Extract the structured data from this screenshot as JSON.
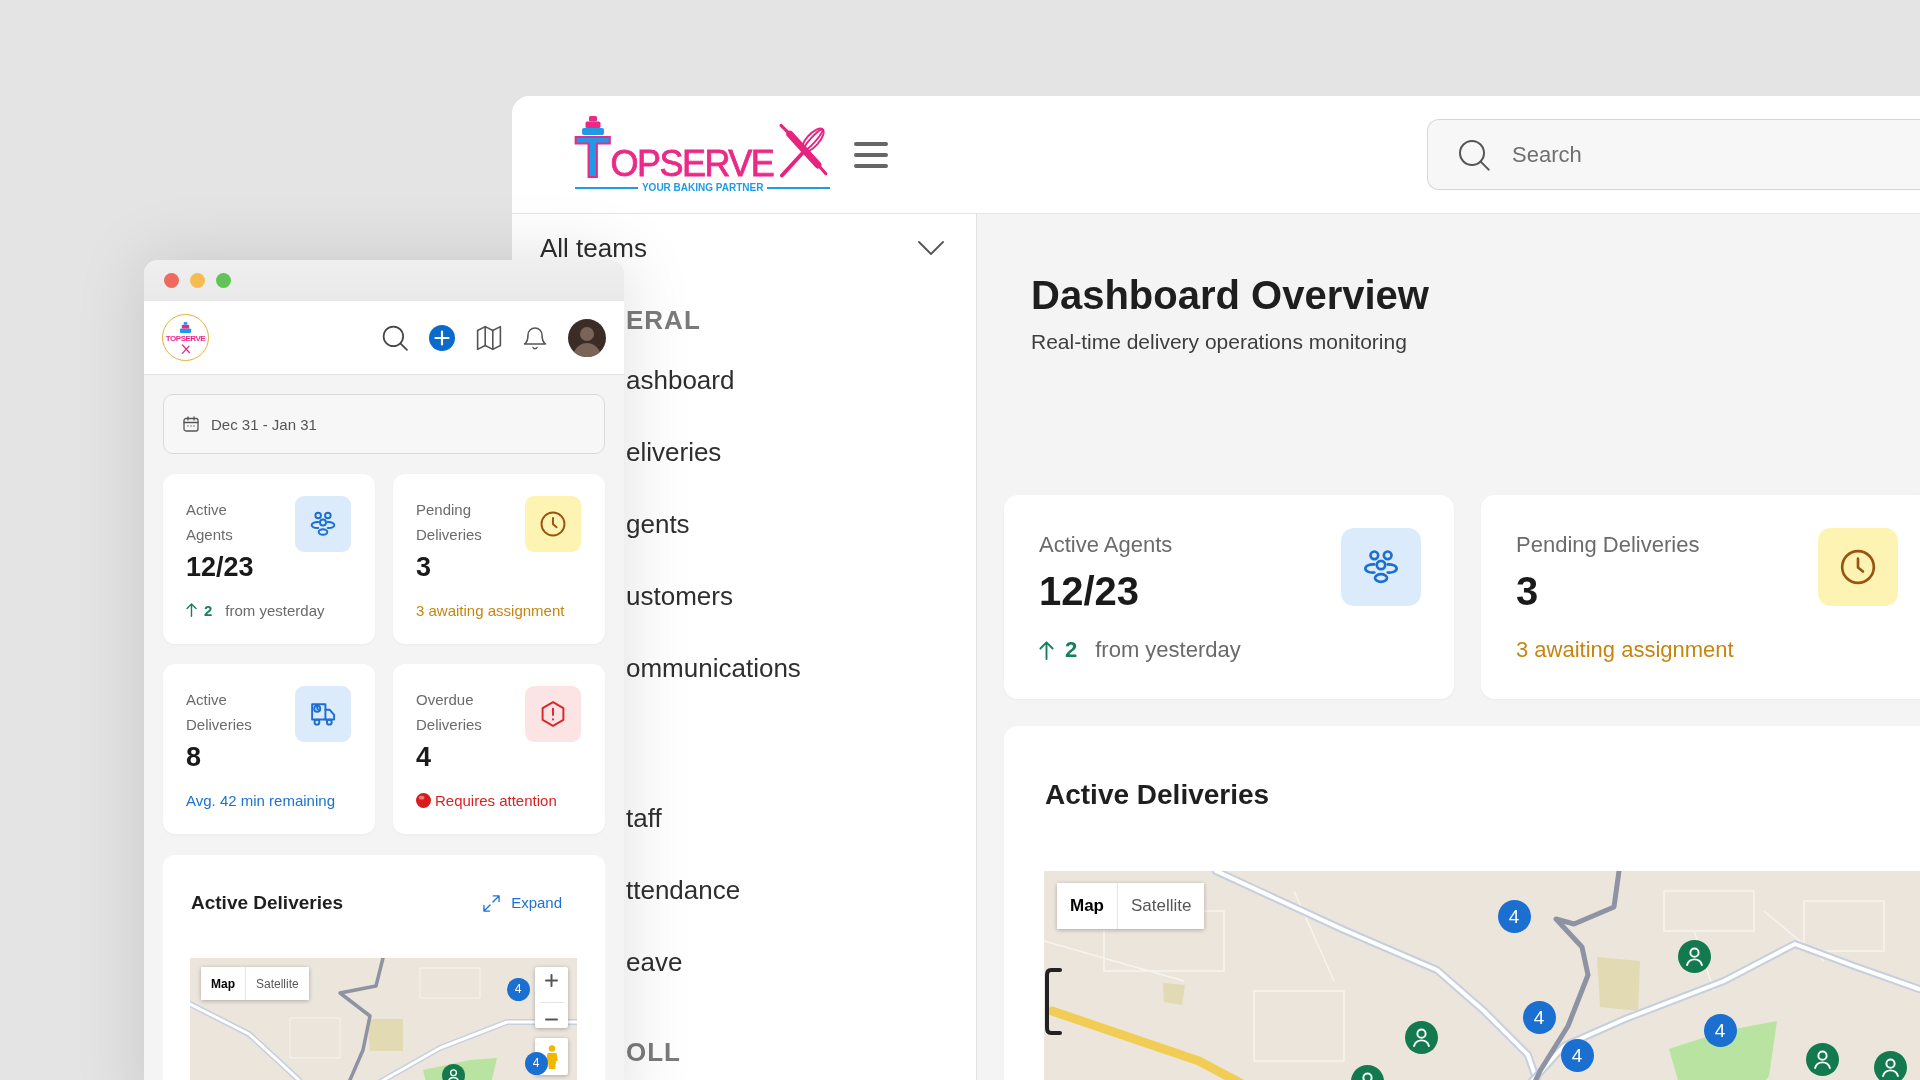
{
  "desktop_window": {
    "header": {
      "logo": {
        "initial": "T",
        "wordmark": "OPSERVE",
        "tagline": "YOUR BAKING PARTNER"
      },
      "search": {
        "placeholder": "Search"
      }
    },
    "sidebar": {
      "team_select": {
        "value": "All teams",
        "expanded": false
      },
      "sections": [
        {
          "heading": "ERAL",
          "items": [
            {
              "label": "ashboard",
              "selected": false
            },
            {
              "label": "eliveries",
              "selected": false
            },
            {
              "label": "gents",
              "selected": false
            },
            {
              "label": "ustomers",
              "selected": false
            },
            {
              "label": "ommunications",
              "selected": false
            }
          ]
        },
        {
          "items": [
            {
              "label": "taff",
              "selected": false
            },
            {
              "label": "ttendance",
              "selected": false
            },
            {
              "label": "eave",
              "selected": false
            }
          ]
        },
        {
          "heading": "OLL"
        }
      ]
    },
    "main": {
      "title": "Dashboard Overview",
      "subtitle": "Real-time delivery operations monitoring",
      "stats": [
        {
          "kind": "agents",
          "label": "Active Agents",
          "value": "12/23",
          "footer": {
            "kind": "trend",
            "delta": "2",
            "text": "from yesterday"
          }
        },
        {
          "kind": "pending",
          "label": "Pending Deliveries",
          "value": "3",
          "footer": {
            "kind": "warning",
            "text": "3 awaiting assignment"
          }
        }
      ],
      "deliveries": {
        "title": "Active Deliveries",
        "map": {
          "modes": [
            {
              "label": "Map",
              "selected": true
            },
            {
              "label": "Satellite",
              "selected": false
            }
          ],
          "markers": [
            {
              "kind": "cluster",
              "label": "4"
            },
            {
              "kind": "agent"
            },
            {
              "kind": "cluster",
              "label": "4"
            },
            {
              "kind": "cluster",
              "label": "4"
            },
            {
              "kind": "agent"
            },
            {
              "kind": "cluster",
              "label": "4"
            },
            {
              "kind": "agent"
            },
            {
              "kind": "agent"
            },
            {
              "kind": "agent"
            }
          ]
        }
      }
    }
  },
  "mobile_window": {
    "header": {
      "logo_text": "TOPSERVE"
    },
    "date_range": {
      "value": "Dec 31 - Jan 31"
    },
    "stats": [
      {
        "kind": "agents",
        "label": "Active Agents",
        "value": "12/23",
        "footer": {
          "kind": "trend",
          "delta": "2",
          "text": "from yesterday"
        }
      },
      {
        "kind": "pending",
        "label": "Pending Deliveries",
        "value": "3",
        "footer": {
          "kind": "warning",
          "text": "3 awaiting assignment"
        }
      },
      {
        "kind": "active",
        "label": "Active Deliveries",
        "value": "8",
        "footer": {
          "kind": "info",
          "text": "Avg. 42 min remaining"
        }
      },
      {
        "kind": "overdue",
        "label": "Overdue Deliveries",
        "value": "4",
        "footer": {
          "kind": "alert",
          "text": "Requires attention"
        }
      }
    ],
    "deliveries": {
      "title": "Active Deliveries",
      "expand": "Expand",
      "map": {
        "modes": [
          {
            "label": "Map",
            "selected": true
          },
          {
            "label": "Satellite",
            "selected": false
          }
        ],
        "markers": [
          {
            "kind": "cluster",
            "label": "4"
          },
          {
            "kind": "cluster",
            "label": "4"
          },
          {
            "kind": "agent"
          }
        ]
      }
    }
  }
}
